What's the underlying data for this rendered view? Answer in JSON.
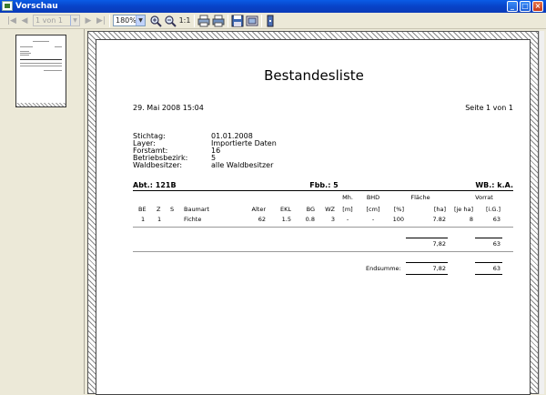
{
  "window": {
    "title": "Vorschau"
  },
  "toolbar": {
    "page_combo": "1 von 1",
    "zoom_combo": "180%",
    "zoom_fit_label": "1:1"
  },
  "report": {
    "title": "Bestandesliste",
    "date": "29. Mai 2008 15:04",
    "page": "Seite 1 von 1",
    "meta": [
      {
        "label": "Stichtag:",
        "value": "01.01.2008"
      },
      {
        "label": "Layer:",
        "value": "Importierte Daten"
      },
      {
        "label": "Forstamt:",
        "value": "16"
      },
      {
        "label": "Betriebsbezirk:",
        "value": "5"
      },
      {
        "label": "Waldbesitzer:",
        "value": "alle Waldbesitzer"
      }
    ],
    "section": {
      "abt": "Abt.: 121B",
      "fbb": "Fbb.: 5",
      "wb": "WB.: k.A."
    },
    "header_top": {
      "mh": "Mh.",
      "bhd": "BHD",
      "flaeche": "Fläche",
      "vorrat": "Vorrat"
    },
    "columns": [
      "BE",
      "Z",
      "S",
      "Baumart",
      "Alter",
      "EKL",
      "BG",
      "WZ",
      "[m]",
      "[cm]",
      "[%]",
      "[ha]",
      "[je ha]",
      "[i.G.]"
    ],
    "rows": [
      [
        "1",
        "1",
        "",
        "Fichte",
        "62",
        "1.5",
        "0.8",
        "3",
        "-",
        "-",
        "100",
        "7.82",
        "8",
        "63"
      ]
    ],
    "subtotal": {
      "ha": "7,82",
      "ig": "63"
    },
    "endsumme": {
      "label": "Endsumme:",
      "ha": "7,82",
      "ig": "63"
    }
  }
}
